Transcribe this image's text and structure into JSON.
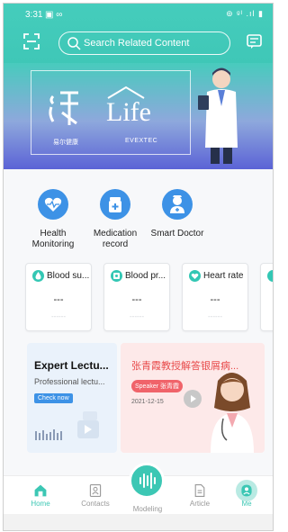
{
  "status_bar": {
    "time": "3:31",
    "indicators": "▣ ∞",
    "right": "⊚ ᵍᴵ .ıl ▮"
  },
  "search": {
    "placeholder": "Search Related Content"
  },
  "banner": {
    "logo_text": "Life",
    "brand_cn": "易尔健康",
    "brand_en": "EVEXTEC"
  },
  "services": [
    {
      "label": "Health\nMonitoring",
      "icon": "heart-monitor-icon"
    },
    {
      "label": "Medication\nrecord",
      "icon": "medicine-icon"
    },
    {
      "label": "Smart Doctor",
      "icon": "doctor-icon"
    }
  ],
  "metrics": [
    {
      "label": "Blood su...",
      "value": "---",
      "sub": "------",
      "icon": "drop-icon"
    },
    {
      "label": "Blood pr...",
      "value": "---",
      "sub": "------",
      "icon": "pressure-icon"
    },
    {
      "label": "Heart rate",
      "value": "---",
      "sub": "------",
      "icon": "heart-icon"
    }
  ],
  "expert_card": {
    "title": "Expert Lectu...",
    "subtitle": "Professional lectu...",
    "button": "Check now"
  },
  "lecture_card": {
    "title": "张青霞教授解答银屑病...",
    "speaker": "Speaker 张青霞",
    "date": "2021-12-15"
  },
  "tabs": [
    {
      "label": "Home",
      "icon": "home-icon",
      "active": true
    },
    {
      "label": "Contacts",
      "icon": "contacts-icon",
      "active": false
    },
    {
      "label": "Modeling",
      "icon": "waveform-icon",
      "active": false
    },
    {
      "label": "Article",
      "icon": "article-icon",
      "active": false
    },
    {
      "label": "Me",
      "icon": "user-icon",
      "active": false
    }
  ],
  "colors": {
    "teal": "#3fc7b7",
    "blue": "#3d92e6",
    "red": "#e84a4a"
  }
}
